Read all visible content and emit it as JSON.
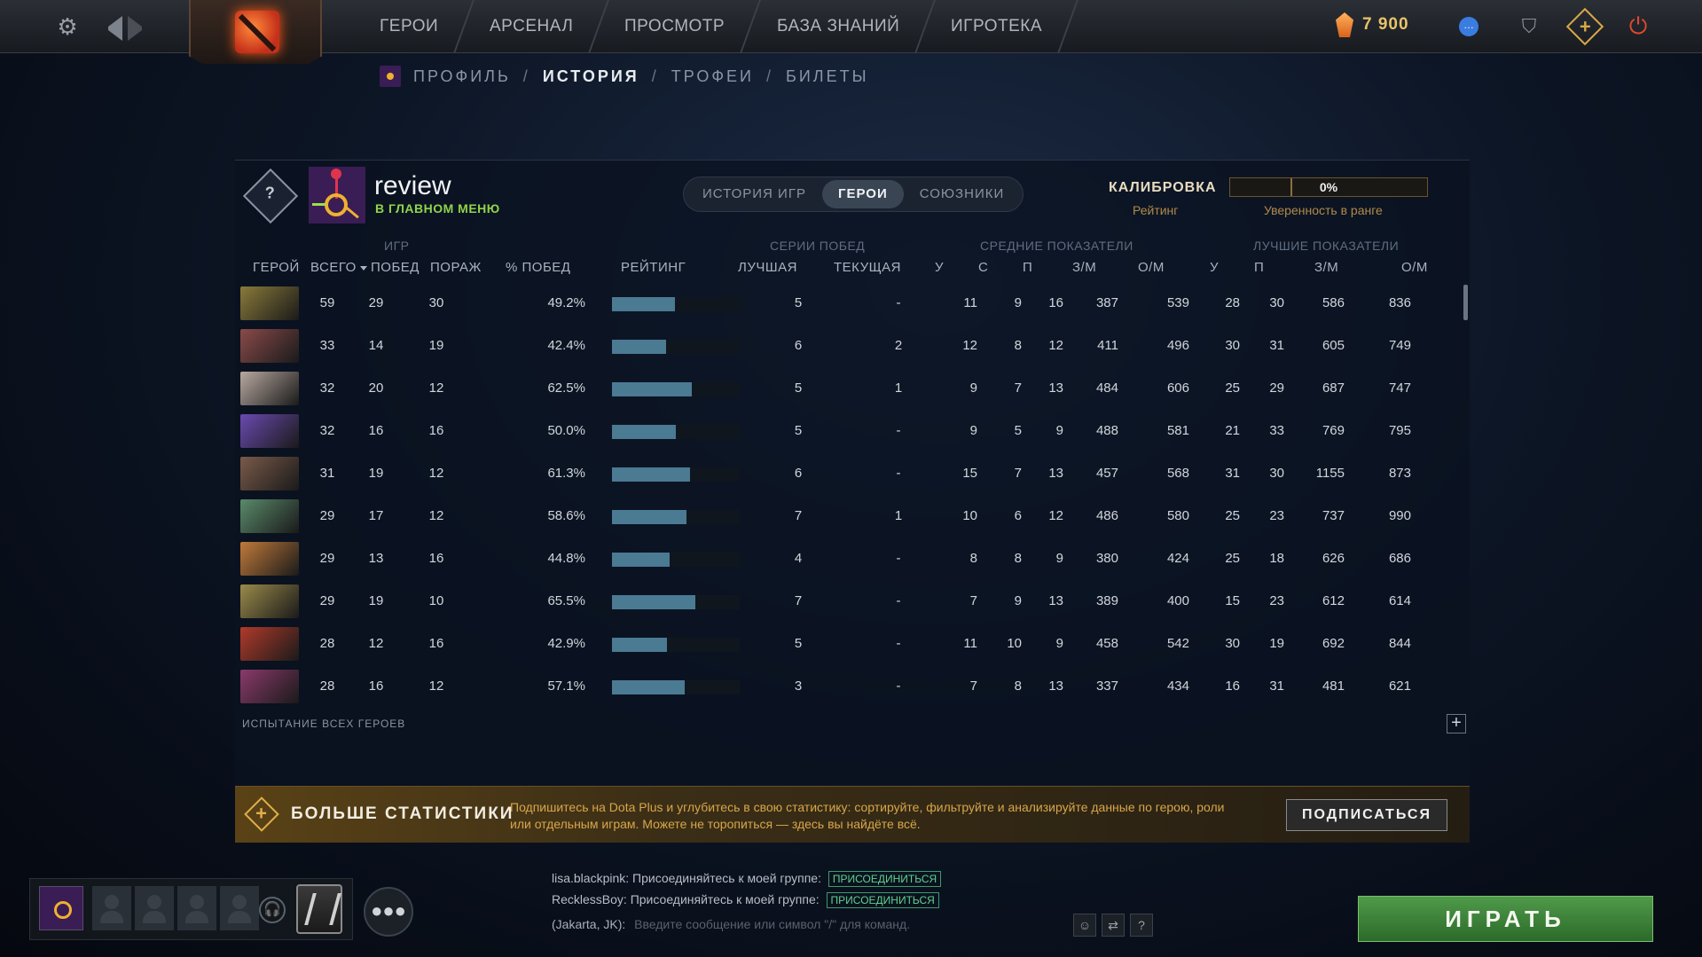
{
  "topbar": {
    "nav": [
      "ГЕРОИ",
      "АРСЕНАЛ",
      "ПРОСМОТР",
      "БАЗА ЗНАНИЙ",
      "ИГРОТЕКА"
    ],
    "shards_value": "7 900",
    "icons": [
      "gear-icon",
      "back-arrow-icon",
      "forward-arrow-icon",
      "dota-logo-icon",
      "shard-icon",
      "chat-icon",
      "armory-icon",
      "dota-plus-icon",
      "power-icon"
    ]
  },
  "breadcrumb": {
    "items": [
      "ПРОФИЛЬ",
      "ИСТОРИЯ",
      "ТРОФЕИ",
      "БИЛЕТЫ"
    ],
    "active": "ИСТОРИЯ",
    "separator": "/"
  },
  "profile": {
    "name": "review",
    "status": "В ГЛАВНОМ МЕНЮ",
    "rank_badge": "?"
  },
  "tabs": {
    "items": [
      "ИСТОРИЯ ИГР",
      "ГЕРОИ",
      "СОЮЗНИКИ"
    ],
    "active": "ГЕРОИ"
  },
  "calibration": {
    "title": "КАЛИБРОВКА",
    "rating_label": "Рейтинг",
    "confidence_value": "0%",
    "confidence_label": "Уверенность в ранге"
  },
  "table": {
    "groups": {
      "games": "ИГР",
      "streaks": "СЕРИИ ПОБЕД",
      "averages": "СРЕДНИЕ ПОКАЗАТЕЛИ",
      "best": "ЛУЧШИЕ ПОКАЗАТЕЛИ"
    },
    "headers": {
      "hero": "ГЕРОЙ",
      "total": "ВСЕГО",
      "wins": "ПОБЕД",
      "losses": "ПОРАЖ",
      "winrate": "% ПОБЕД",
      "rating": "РЕЙТИНГ",
      "best_streak": "ЛУЧШАЯ",
      "current_streak": "ТЕКУЩАЯ",
      "avg_k": "У",
      "avg_d": "С",
      "avg_a": "П",
      "avg_gpm": "З/М",
      "avg_xpm": "О/М",
      "best_k": "У",
      "best_a": "П",
      "best_gpm": "З/М",
      "best_xpm": "О/М"
    },
    "rows": [
      {
        "color": "#8a7a3a",
        "total": "59",
        "wins": "29",
        "losses": "30",
        "winrate": "49.2%",
        "wr": 0.492,
        "best_streak": "5",
        "current_streak": "-",
        "avg_k": "11",
        "avg_d": "9",
        "avg_a": "16",
        "avg_gpm": "387",
        "avg_xpm": "539",
        "best_k": "28",
        "best_a": "30",
        "best_gpm": "586",
        "best_xpm": "836"
      },
      {
        "color": "#8a4a4a",
        "total": "33",
        "wins": "14",
        "losses": "19",
        "winrate": "42.4%",
        "wr": 0.424,
        "best_streak": "6",
        "current_streak": "2",
        "avg_k": "12",
        "avg_d": "8",
        "avg_a": "12",
        "avg_gpm": "411",
        "avg_xpm": "496",
        "best_k": "30",
        "best_a": "31",
        "best_gpm": "605",
        "best_xpm": "749"
      },
      {
        "color": "#b8a8a0",
        "total": "32",
        "wins": "20",
        "losses": "12",
        "winrate": "62.5%",
        "wr": 0.625,
        "best_streak": "5",
        "current_streak": "1",
        "avg_k": "9",
        "avg_d": "7",
        "avg_a": "13",
        "avg_gpm": "484",
        "avg_xpm": "606",
        "best_k": "25",
        "best_a": "29",
        "best_gpm": "687",
        "best_xpm": "747"
      },
      {
        "color": "#6a4ab0",
        "total": "32",
        "wins": "16",
        "losses": "16",
        "winrate": "50.0%",
        "wr": 0.5,
        "best_streak": "5",
        "current_streak": "-",
        "avg_k": "9",
        "avg_d": "5",
        "avg_a": "9",
        "avg_gpm": "488",
        "avg_xpm": "581",
        "best_k": "21",
        "best_a": "33",
        "best_gpm": "769",
        "best_xpm": "795"
      },
      {
        "color": "#7a5a4a",
        "total": "31",
        "wins": "19",
        "losses": "12",
        "winrate": "61.3%",
        "wr": 0.613,
        "best_streak": "6",
        "current_streak": "-",
        "avg_k": "15",
        "avg_d": "7",
        "avg_a": "13",
        "avg_gpm": "457",
        "avg_xpm": "568",
        "best_k": "31",
        "best_a": "30",
        "best_gpm": "1155",
        "best_xpm": "873"
      },
      {
        "color": "#5a8a6a",
        "total": "29",
        "wins": "17",
        "losses": "12",
        "winrate": "58.6%",
        "wr": 0.586,
        "best_streak": "7",
        "current_streak": "1",
        "avg_k": "10",
        "avg_d": "6",
        "avg_a": "12",
        "avg_gpm": "486",
        "avg_xpm": "580",
        "best_k": "25",
        "best_a": "23",
        "best_gpm": "737",
        "best_xpm": "990"
      },
      {
        "color": "#c07a3a",
        "total": "29",
        "wins": "13",
        "losses": "16",
        "winrate": "44.8%",
        "wr": 0.448,
        "best_streak": "4",
        "current_streak": "-",
        "avg_k": "8",
        "avg_d": "8",
        "avg_a": "9",
        "avg_gpm": "380",
        "avg_xpm": "424",
        "best_k": "25",
        "best_a": "18",
        "best_gpm": "626",
        "best_xpm": "686"
      },
      {
        "color": "#9a8a4a",
        "total": "29",
        "wins": "19",
        "losses": "10",
        "winrate": "65.5%",
        "wr": 0.655,
        "best_streak": "7",
        "current_streak": "-",
        "avg_k": "7",
        "avg_d": "9",
        "avg_a": "13",
        "avg_gpm": "389",
        "avg_xpm": "400",
        "best_k": "15",
        "best_a": "23",
        "best_gpm": "612",
        "best_xpm": "614"
      },
      {
        "color": "#b03a2a",
        "total": "28",
        "wins": "12",
        "losses": "16",
        "winrate": "42.9%",
        "wr": 0.429,
        "best_streak": "5",
        "current_streak": "-",
        "avg_k": "11",
        "avg_d": "10",
        "avg_a": "9",
        "avg_gpm": "458",
        "avg_xpm": "542",
        "best_k": "30",
        "best_a": "19",
        "best_gpm": "692",
        "best_xpm": "844"
      },
      {
        "color": "#8a3a6a",
        "total": "28",
        "wins": "16",
        "losses": "12",
        "winrate": "57.1%",
        "wr": 0.571,
        "best_streak": "3",
        "current_streak": "-",
        "avg_k": "7",
        "avg_d": "8",
        "avg_a": "13",
        "avg_gpm": "337",
        "avg_xpm": "434",
        "best_k": "16",
        "best_a": "31",
        "best_gpm": "481",
        "best_xpm": "621"
      }
    ],
    "all_heroes_label": "ИСПЫТАНИЕ ВСЕХ ГЕРОЕВ"
  },
  "plus_banner": {
    "title": "БОЛЬШЕ СТАТИСТИКИ",
    "description": "Подпишитесь на Dota Plus и углубитесь в свою статистику: сортируйте, фильтруйте и анализируйте данные по герою, роли или отдельным играм. Можете не торопиться — здесь вы найдёте всё.",
    "button": "ПОДПИСАТЬСЯ"
  },
  "chat": {
    "lines": [
      {
        "user": "lisa.blackpink:",
        "text": "Присоединяйтесь к моей группе:",
        "button": "ПРИСОЕДИНИТЬСЯ"
      },
      {
        "user": "RecklessBoy:",
        "text": "Присоединяйтесь к моей группе:",
        "button": "ПРИСОЕДИНИТЬСЯ"
      }
    ],
    "channel": "(Jakarta, JK):",
    "placeholder": "Введите сообщение или символ \"/\" для команд.",
    "help": "?"
  },
  "play_button": "ИГРАТЬ"
}
